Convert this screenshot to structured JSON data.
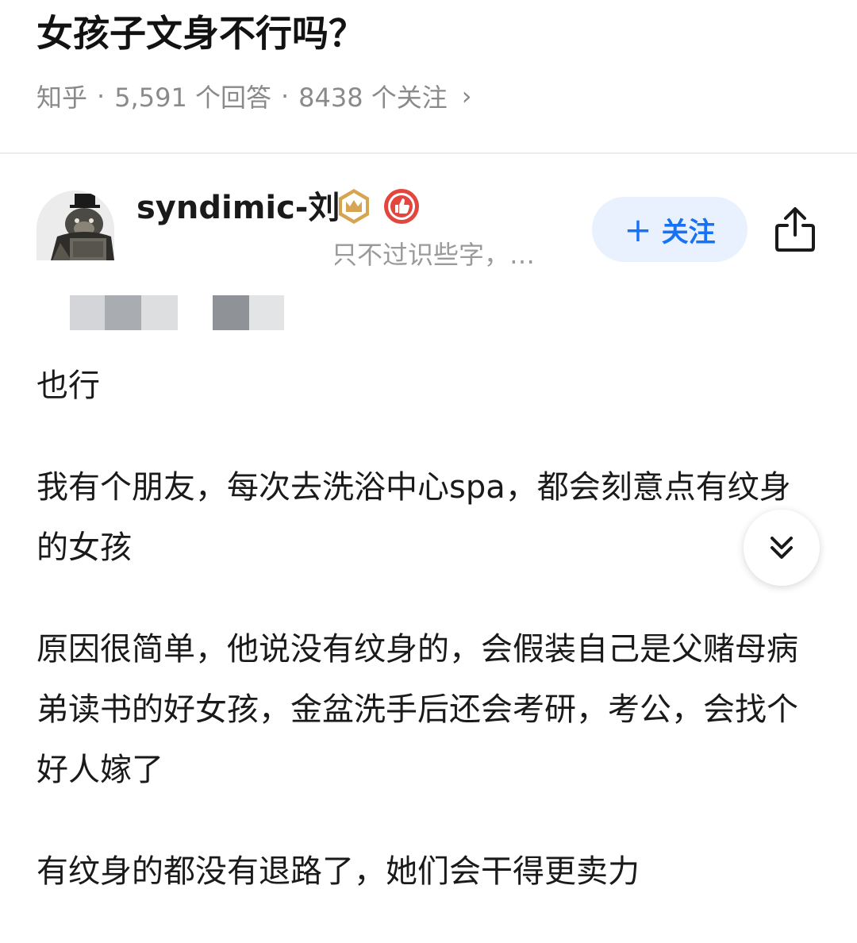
{
  "question": {
    "title": "女孩子文身不行吗？",
    "source": "知乎",
    "answers": "5,591 个回答",
    "followers": "8438 个关注",
    "separator": "·",
    "chevron": "›"
  },
  "author": {
    "name": "syndimic-刘",
    "bio_visible": "只不过识些字，…",
    "badges": [
      "crown-badge-icon",
      "like-badge-icon"
    ],
    "follow_label": "关注",
    "follow_plus": "+"
  },
  "answer": {
    "paragraphs": [
      "也行",
      "我有个朋友，每次去洗浴中心spa，都会刻意点有纹身的女孩",
      "原因很简单，他说没有纹身的，会假装自己是父赌母病弟读书的好女孩，金盆洗手后还会考研，考公，会找个好人嫁了",
      "有纹身的都没有退路了，她们会干得更卖力"
    ]
  },
  "colors": {
    "accent": "#1772f6",
    "follow_bg": "#e8f1fd",
    "meta_text": "#8a8a8a",
    "crown_badge": "#d6a552",
    "like_badge": "#e2463f"
  },
  "icons": {
    "share": "share-icon",
    "scroll_down": "double-chevron-down-icon"
  }
}
